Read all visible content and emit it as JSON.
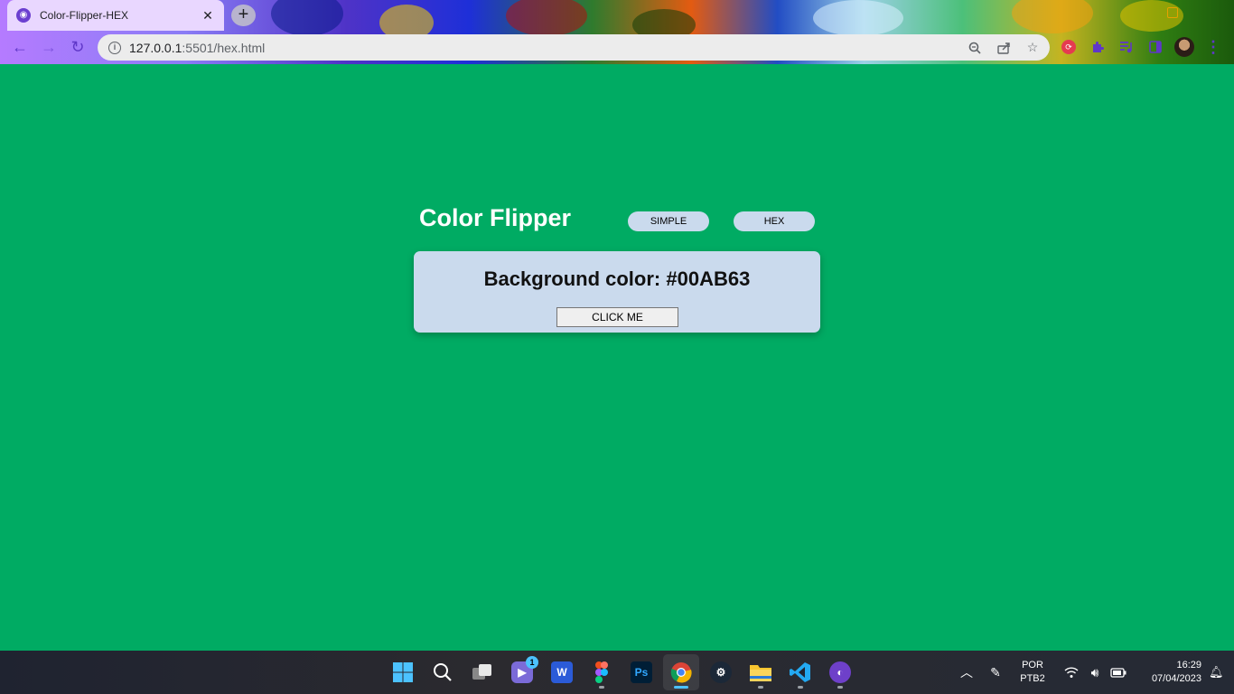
{
  "browser": {
    "tab_title": "Color-Flipper-HEX",
    "tab_close": "✕",
    "new_tab": "+",
    "url_host": "127.0.0.1",
    "url_path": ":5501/hex.html",
    "accent_color": "#5f37c8"
  },
  "page": {
    "background_color": "#00AB63",
    "title": "Color Flipper",
    "nav": [
      {
        "label": "SIMPLE"
      },
      {
        "label": "HEX"
      }
    ],
    "card": {
      "label": "Background color: ",
      "color_value": "#00AB63",
      "button_label": "CLICK ME"
    }
  },
  "taskbar": {
    "apps": [
      {
        "name": "windows-start",
        "glyph": ""
      },
      {
        "name": "search",
        "glyph": ""
      },
      {
        "name": "task-view",
        "glyph": ""
      },
      {
        "name": "chat",
        "glyph": "",
        "badge": "1"
      },
      {
        "name": "word",
        "glyph": "W"
      },
      {
        "name": "figma",
        "glyph": ""
      },
      {
        "name": "photoshop",
        "glyph": "Ps"
      },
      {
        "name": "chrome",
        "glyph": ""
      },
      {
        "name": "steam",
        "glyph": ""
      },
      {
        "name": "file-explorer",
        "glyph": ""
      },
      {
        "name": "vscode",
        "glyph": ""
      },
      {
        "name": "github-desktop",
        "glyph": ""
      }
    ],
    "language_line1": "POR",
    "language_line2": "PTB2",
    "time": "16:29",
    "date": "07/04/2023"
  }
}
